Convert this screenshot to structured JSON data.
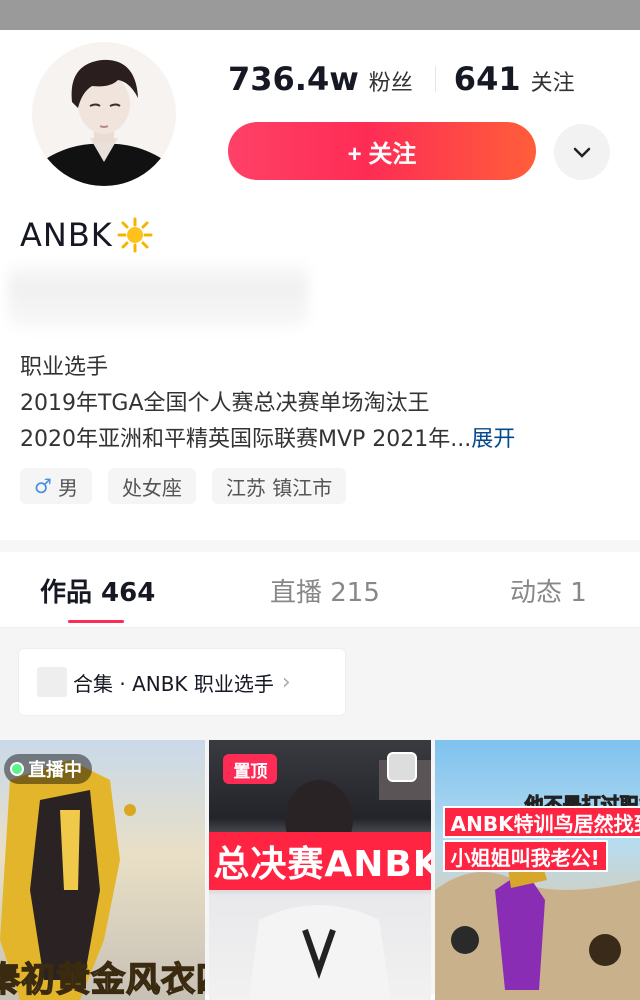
{
  "profile": {
    "name": "ANBK",
    "followers_count": "736.4w",
    "followers_label": "粉丝",
    "following_count": "641",
    "following_label": "关注",
    "follow_button_label": "+ 关注",
    "bio_lines": [
      "职业选手",
      "2019年TGA全国个人赛总决赛单场淘汰王",
      "2020年亚洲和平精英国际联赛MVP 2021年..."
    ],
    "bio_expand": "展开",
    "tags": {
      "gender": "男",
      "gender_icon": "male-icon",
      "zodiac": "处女座",
      "location": "江苏 镇江市"
    }
  },
  "tabs": [
    {
      "label": "作品 464",
      "active": true
    },
    {
      "label": "直播 215",
      "active": false
    },
    {
      "label": "动态 1",
      "active": false
    }
  ],
  "collection": {
    "label": "合集 · ANBK 职业选手",
    "arrow_icon": "chevron-right-icon"
  },
  "videos": [
    {
      "badge": "直播中",
      "caption": "秦初黄金风衣四"
    },
    {
      "badge": "置顶",
      "caption": "总决赛ANBK居"
    },
    {
      "top_text": "他不是打过职业的",
      "line1": "ANBK特训鸟居然找到",
      "line2": "小姐姐叫我老公!"
    }
  ],
  "colors": {
    "accent": "#fe2c55",
    "link": "#04498d"
  }
}
